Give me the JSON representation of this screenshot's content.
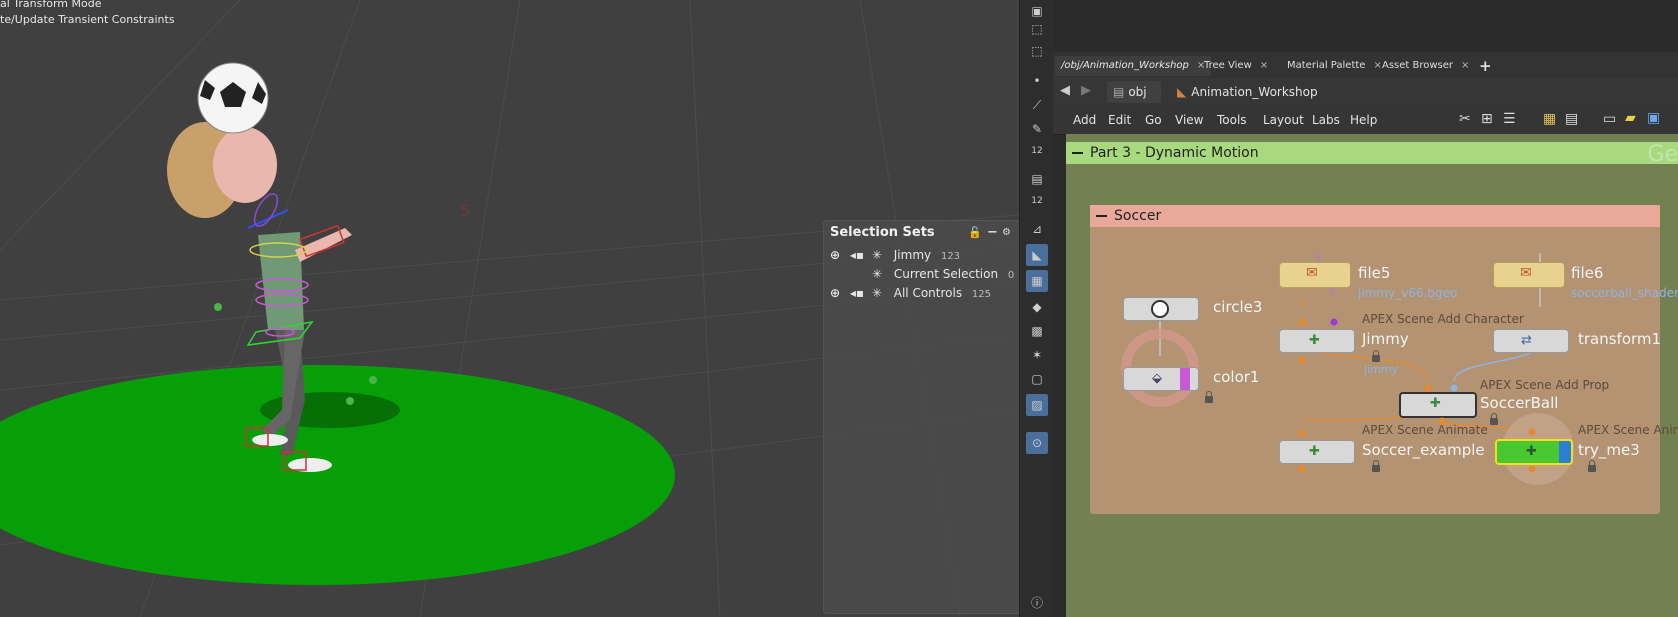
{
  "viewport": {
    "overlay_lines": [
      "al Transform Mode",
      "te/Update Transient Constraints"
    ]
  },
  "selection_sets": {
    "title": "Selection Sets",
    "rows": [
      {
        "label": "Jimmy",
        "count": "123"
      },
      {
        "label": "Current Selection",
        "count": "0"
      },
      {
        "label": "All Controls",
        "count": "125"
      }
    ]
  },
  "shelf_tools": {
    "labels": [
      "12",
      "12"
    ]
  },
  "network_pane": {
    "tabs": [
      {
        "label": "/obj/Animation_Workshop",
        "close": "×"
      },
      {
        "label": "Tree View",
        "close": "×"
      },
      {
        "label": "Material Palette",
        "close": "×"
      },
      {
        "label": "Asset Browser",
        "close": "×"
      }
    ],
    "add_tab": "+",
    "path": [
      "obj",
      "Animation_Workshop"
    ],
    "menus": [
      "Add",
      "Edit",
      "Go",
      "View",
      "Tools",
      "Layout",
      "Labs",
      "Help"
    ]
  },
  "network": {
    "outer_box": {
      "title": "Part 3 - Dynamic Motion",
      "watermark": "Ge",
      "color": "#a8d97f"
    },
    "inner_box": {
      "title": "Soccer",
      "color": "#e8a89a"
    },
    "nodes": {
      "circle3": {
        "name": "circle3"
      },
      "color1": {
        "name": "color1"
      },
      "file5": {
        "name": "file5",
        "param": "jimmy_v66.bgeo"
      },
      "file6": {
        "name": "file6",
        "param": "soccerball_shaders"
      },
      "jimmy": {
        "name": "Jimmy",
        "type": "APEX Scene Add Character",
        "wire_label": "jimmy"
      },
      "transform1": {
        "name": "transform1"
      },
      "soccerball": {
        "name": "SoccerBall",
        "type": "APEX Scene Add Prop"
      },
      "soccer_example": {
        "name": "Soccer_example",
        "type": "APEX Scene Animate"
      },
      "try_me3": {
        "name": "try_me3",
        "type": "APEX Scene Anima"
      }
    }
  },
  "colors": {
    "ground": "#079f07",
    "network_bg": "#728052",
    "selected_node": "#49c730"
  }
}
